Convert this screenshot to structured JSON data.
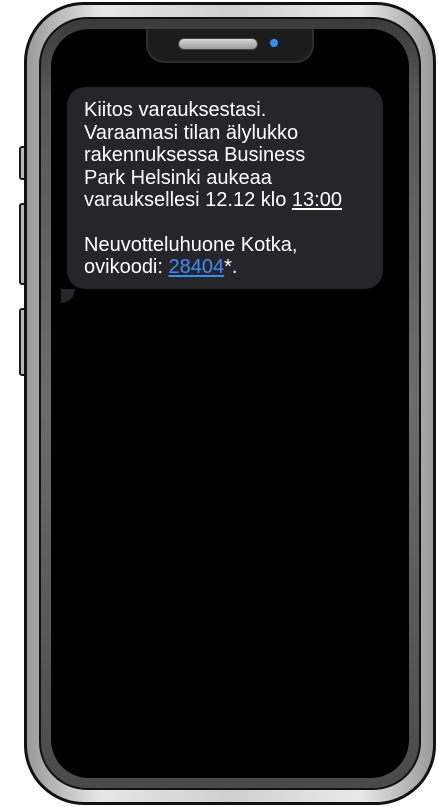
{
  "message": {
    "line1": "Kiitos varauksestasi.",
    "line2": "Varaamasi tilan älylukko",
    "line3": "rakennuksessa Business",
    "line4": "Park Helsinki aukeaa",
    "line5_prefix": "varaukselle si 12.12 klo ",
    "time": "13:00",
    "line6": "Neuvotteluhuone Kotka,",
    "line7_prefix": "ovikoodi: ",
    "door_code": "28404",
    "line7_suffix": "*."
  },
  "colors": {
    "link": "#3a8dff",
    "bubble": "#262628",
    "screen": "#000000",
    "camera": "#2f8fff"
  },
  "icons": {
    "speaker": "earpiece-speaker-icon",
    "camera": "front-camera-icon"
  }
}
